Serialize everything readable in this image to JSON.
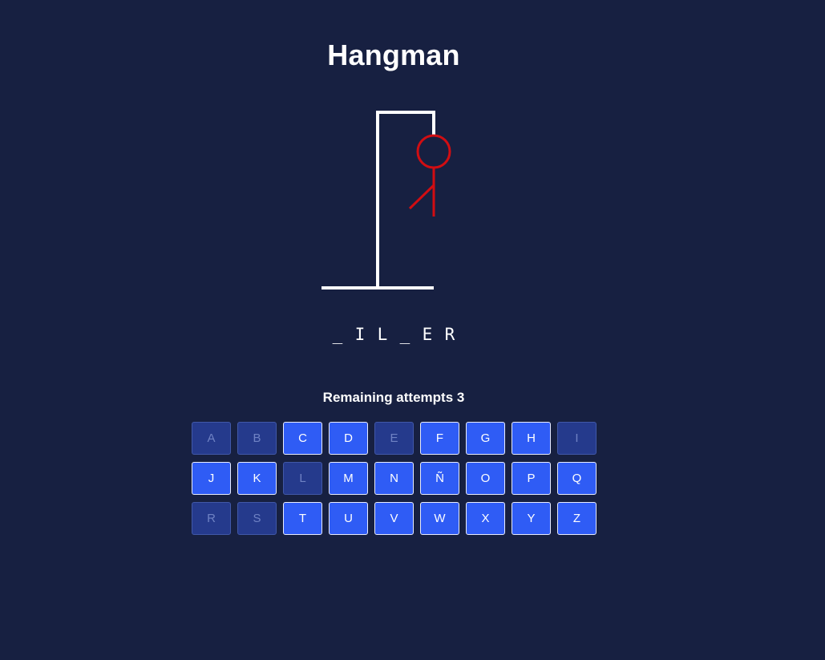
{
  "game": {
    "title": "Hangman",
    "word_slots": [
      "_",
      "I",
      "L",
      "_",
      "E",
      "R"
    ],
    "attempts_label": "Remaining attempts",
    "attempts_value": 3,
    "attempts_text": "Remaining attempts 3"
  },
  "colors": {
    "background": "#172041",
    "gallows": "#ffffff",
    "figure": "#d10d12",
    "key_active": "#2f5cf5",
    "key_used": "#253a8c"
  },
  "figure_parts_drawn": [
    "head",
    "body",
    "left-arm"
  ],
  "keyboard": {
    "keys": [
      {
        "letter": "A",
        "used": true
      },
      {
        "letter": "B",
        "used": true
      },
      {
        "letter": "C",
        "used": false
      },
      {
        "letter": "D",
        "used": false
      },
      {
        "letter": "E",
        "used": true
      },
      {
        "letter": "F",
        "used": false
      },
      {
        "letter": "G",
        "used": false
      },
      {
        "letter": "H",
        "used": false
      },
      {
        "letter": "I",
        "used": true
      },
      {
        "letter": "J",
        "used": false
      },
      {
        "letter": "K",
        "used": false
      },
      {
        "letter": "L",
        "used": true
      },
      {
        "letter": "M",
        "used": false
      },
      {
        "letter": "N",
        "used": false
      },
      {
        "letter": "Ñ",
        "used": false
      },
      {
        "letter": "O",
        "used": false
      },
      {
        "letter": "P",
        "used": false
      },
      {
        "letter": "Q",
        "used": false
      },
      {
        "letter": "R",
        "used": true
      },
      {
        "letter": "S",
        "used": true
      },
      {
        "letter": "T",
        "used": false
      },
      {
        "letter": "U",
        "used": false
      },
      {
        "letter": "V",
        "used": false
      },
      {
        "letter": "W",
        "used": false
      },
      {
        "letter": "X",
        "used": false
      },
      {
        "letter": "Y",
        "used": false
      },
      {
        "letter": "Z",
        "used": false
      }
    ]
  }
}
